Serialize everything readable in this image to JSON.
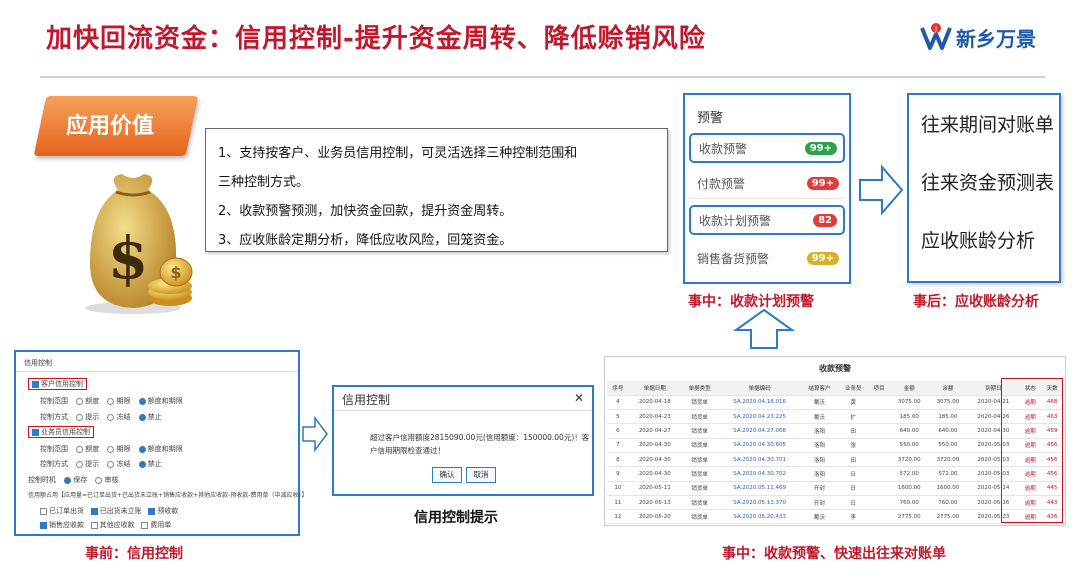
{
  "header": {
    "title": "加快回流资金：信用控制-提升资金周转、降低赊销风险",
    "logo_text": "新乡万景"
  },
  "badge": {
    "label": "应用价值"
  },
  "description": {
    "lines": [
      "1、支持按客户、业务员信用控制，可灵活选择三种控制范围和",
      "三种控制方式。",
      "2、收款预警预测，加快资金回款，提升资金周转。",
      "3、应收账龄定期分析，降低应收风险，回笼资金。"
    ]
  },
  "warning_panel": {
    "title": "预警",
    "items": [
      {
        "label": "收款预警",
        "count": "99+",
        "color": "#2aa34a",
        "highlighted": true
      },
      {
        "label": "付款预警",
        "count": "99+",
        "color": "#e23b3b",
        "highlighted": false
      },
      {
        "label": "收款计划预警",
        "count": "82",
        "color": "#e23b3b",
        "highlighted": true
      },
      {
        "label": "销售备货预警",
        "count": "99+",
        "color": "#d6b22a",
        "highlighted": false
      }
    ],
    "caption": "事中：收款计划预警"
  },
  "after_panel": {
    "items": [
      "往来期间对账单",
      "往来资金预测表",
      "应收账龄分析"
    ],
    "caption": "事后：应收账龄分析"
  },
  "credit_settings": {
    "title": "信用控制",
    "customer_credit": "客户信用控制",
    "salesperson_credit": "业务员信用控制",
    "scope_label": "控制范围",
    "scope_options": [
      "额度",
      "期限",
      "额度和期限"
    ],
    "mode_label": "控制方式",
    "mode_options": [
      "提示",
      "冻结",
      "禁止"
    ],
    "timing_label": "控制时机",
    "timing_options": [
      "保存",
      "审核"
    ],
    "formula_text": "信用额占用【应用量=已订单出货+已出货未立账+销售应收款+其他应收款-预收款-费用单（中减应收）】",
    "check_items": [
      "已订单出货",
      "已出货未立账",
      "预收款",
      "销售应收款",
      "其他应收款",
      "费用单"
    ],
    "caption": "事前：信用控制"
  },
  "credit_dialog": {
    "title": "信用控制",
    "message": "超过客户信用额度2815090.00元(信用额度：150000.00元)！客户信用期限检查通过！",
    "confirm": "确认",
    "cancel": "取消",
    "caption": "信用控制提示"
  },
  "receivable_table": {
    "title": "收款预警",
    "columns": [
      "序号",
      "单据日期",
      "单据类型",
      "单据编码",
      "结算客户",
      "业务员",
      "项目",
      "金额",
      "余额",
      "到期日",
      "状态",
      "天数"
    ],
    "rows": [
      [
        "4",
        "2020-04-18",
        "销货单",
        "SA.2020.04.18.016",
        "戴沃",
        "黄",
        "",
        "3075.00",
        "3075.00",
        "2020-04-21",
        "逾期",
        "468"
      ],
      [
        "5",
        "2020-04-23",
        "销货单",
        "SA.2020.04.23.225",
        "戴沃",
        "扩",
        "",
        "185.00",
        "185.00",
        "2020-04-26",
        "逾期",
        "463"
      ],
      [
        "6",
        "2020-04-27",
        "销货单",
        "SA.2020.04.27.066",
        "洛阳",
        "田",
        "",
        "640.00",
        "640.00",
        "2020-04-30",
        "逾期",
        "459"
      ],
      [
        "7",
        "2020-04-30",
        "销货单",
        "SA.2020.04.30.605",
        "洛阳",
        "张",
        "",
        "550.00",
        "550.00",
        "2020-05-03",
        "逾期",
        "456"
      ],
      [
        "8",
        "2020-04-30",
        "销货单",
        "SA.2020.04.30.701",
        "洛阳",
        "田",
        "",
        "3720.00",
        "3720.00",
        "2020-05-03",
        "逾期",
        "456"
      ],
      [
        "9",
        "2020-04-30",
        "销货单",
        "SA.2020.04.30.702",
        "洛阳",
        "日",
        "",
        "572.00",
        "572.00",
        "2020-05-03",
        "逾期",
        "456"
      ],
      [
        "10",
        "2020-05-11",
        "销货单",
        "SA.2020.05.11.469",
        "开封",
        "日",
        "",
        "1600.00",
        "1600.00",
        "2020-05-14",
        "逾期",
        "445"
      ],
      [
        "11",
        "2020-05-13",
        "销货单",
        "SA.2020.05.13.370",
        "开封",
        "日",
        "",
        "760.00",
        "760.00",
        "2020-05-16",
        "逾期",
        "443"
      ],
      [
        "12",
        "2020-05-20",
        "销货单",
        "SA.2020.05.20.433",
        "戴沃",
        "李",
        "",
        "2775.00",
        "2775.00",
        "2020-05-23",
        "逾期",
        "436"
      ]
    ],
    "caption": "事中：收款预警、快速出往来对账单"
  }
}
